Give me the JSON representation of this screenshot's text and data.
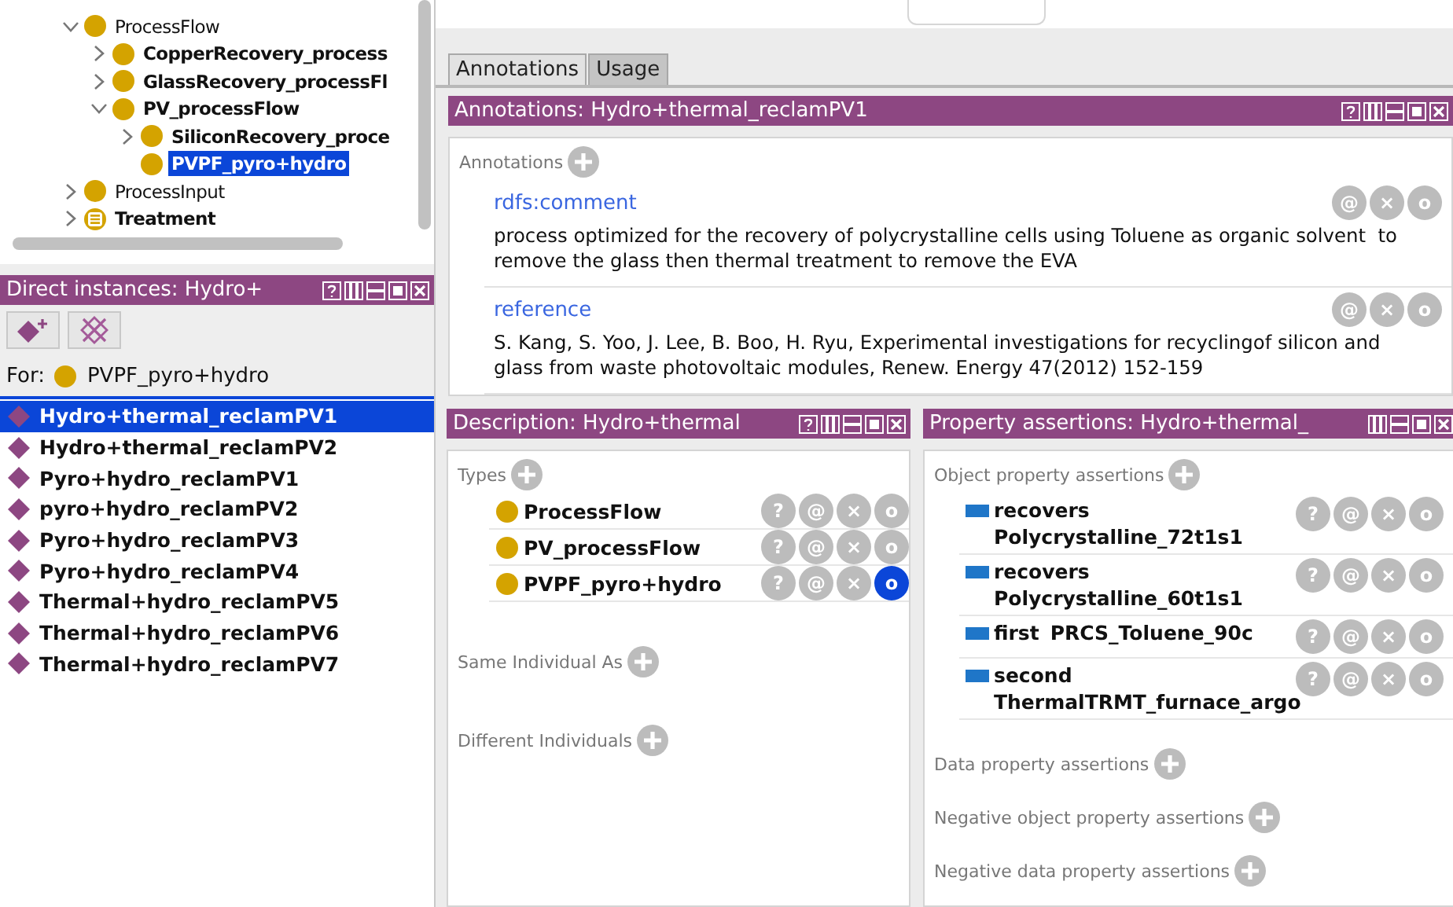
{
  "tree": [
    {
      "label": "ProcessFlow",
      "kind": "class",
      "bold": false,
      "expanded": true,
      "selected": false,
      "children": [
        {
          "label": "CopperRecovery_process",
          "kind": "class",
          "bold": true,
          "expanded": false,
          "selected": false
        },
        {
          "label": "GlassRecovery_processFl",
          "kind": "class",
          "bold": true,
          "expanded": false,
          "selected": false
        },
        {
          "label": "PV_processFlow",
          "kind": "class",
          "bold": true,
          "expanded": true,
          "selected": false,
          "children": [
            {
              "label": "SiliconRecovery_proce",
              "kind": "class",
              "bold": true,
              "expanded": false,
              "selected": false
            },
            {
              "label": "PVPF_pyro+hydro",
              "kind": "class",
              "bold": true,
              "selected": true
            }
          ]
        }
      ]
    },
    {
      "label": "ProcessInput",
      "kind": "class",
      "bold": false,
      "expanded": false,
      "selected": false
    },
    {
      "label": "Treatment",
      "kind": "defined",
      "bold": true,
      "expanded": false,
      "selected": false
    }
  ],
  "instances_panel": {
    "title": "Direct instances: Hydro+",
    "for_label": "For:",
    "for_class": "PVPF_pyro+hydro",
    "items": [
      {
        "label": "Hydro+thermal_reclamPV1",
        "selected": true
      },
      {
        "label": "Hydro+thermal_reclamPV2",
        "selected": false
      },
      {
        "label": "Pyro+hydro_reclamPV1",
        "selected": false
      },
      {
        "label": "pyro+hydro_reclamPV2",
        "selected": false
      },
      {
        "label": "Pyro+hydro_reclamPV3",
        "selected": false
      },
      {
        "label": "Pyro+hydro_reclamPV4",
        "selected": false
      },
      {
        "label": "Thermal+hydro_reclamPV5",
        "selected": false
      },
      {
        "label": "Thermal+hydro_reclamPV6",
        "selected": false
      },
      {
        "label": "Thermal+hydro_reclamPV7",
        "selected": false
      }
    ]
  },
  "tabs": [
    {
      "label": "Annotations",
      "selected": true
    },
    {
      "label": "Usage",
      "selected": false
    }
  ],
  "annotations_panel": {
    "title": "Annotations: Hydro+thermal_reclamPV1",
    "section_label": "Annotations",
    "items": [
      {
        "property": "rdfs:comment",
        "value": "process optimized for the recovery of polycrystalline cells using Toluene as organic solvent  to remove the glass then thermal treatment to remove the EVA",
        "actions": [
          "@",
          "×",
          "o"
        ]
      },
      {
        "property": "reference",
        "value": "S. Kang, S. Yoo, J. Lee, B. Boo, H. Ryu, Experimental investigations for recyclingof silicon and glass from waste photovoltaic modules, Renew. Energy 47(2012) 152-159",
        "actions": [
          "@",
          "×",
          "o"
        ]
      }
    ]
  },
  "description_panel": {
    "title": "Description: Hydro+thermal",
    "sections": [
      {
        "label": "Types",
        "items": [
          {
            "label": "ProcessFlow",
            "focused": false,
            "actions": [
              "?",
              "@",
              "×",
              "o"
            ]
          },
          {
            "label": "PV_processFlow",
            "focused": false,
            "actions": [
              "?",
              "@",
              "×",
              "o"
            ]
          },
          {
            "label": "PVPF_pyro+hydro",
            "focused": true,
            "actions": [
              "?",
              "@",
              "×",
              "o"
            ]
          }
        ]
      },
      {
        "label": "Same Individual As"
      },
      {
        "label": "Different Individuals"
      }
    ]
  },
  "property_panel": {
    "title": "Property assertions: Hydro+thermal_",
    "sections": [
      {
        "label": "Object property assertions",
        "items": [
          {
            "property": "recovers",
            "value": "Polycrystalline_72t1s1",
            "actions": [
              "?",
              "@",
              "×",
              "o"
            ]
          },
          {
            "property": "recovers",
            "value": "Polycrystalline_60t1s1",
            "actions": [
              "?",
              "@",
              "×",
              "o"
            ]
          },
          {
            "property": "first",
            "value": "PRCS_Toluene_90c",
            "actions": [
              "?",
              "@",
              "×",
              "o"
            ]
          },
          {
            "property": "second",
            "value": "ThermalTRMT_furnace_argo",
            "actions": [
              "?",
              "@",
              "×",
              "o"
            ]
          }
        ]
      },
      {
        "label": "Data property assertions"
      },
      {
        "label": "Negative object property assertions"
      },
      {
        "label": "Negative data property assertions"
      }
    ]
  }
}
